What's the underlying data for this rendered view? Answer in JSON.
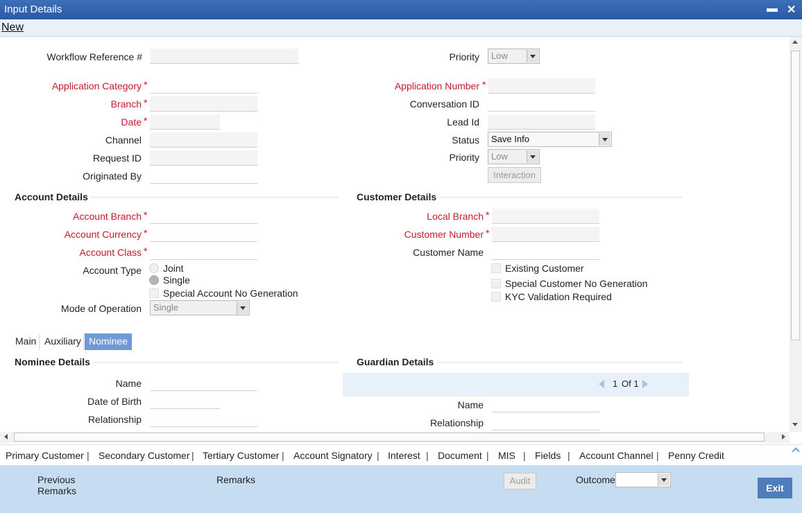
{
  "window": {
    "title": "Input Details",
    "minimize": "▬",
    "close": "✕"
  },
  "menu": {
    "new": "New"
  },
  "header": {
    "workflow_ref_label": "Workflow Reference #",
    "priority_label": "Priority",
    "priority_value": "Low",
    "app_category_label": "Application Category",
    "app_number_label": "Application Number",
    "branch_label": "Branch",
    "conversation_label": "Conversation ID",
    "date_label": "Date",
    "lead_label": "Lead Id",
    "channel_label": "Channel",
    "status_label": "Status",
    "status_value": "Save Info",
    "request_label": "Request ID",
    "priority2_label": "Priority",
    "priority2_value": "Low",
    "originated_label": "Originated By",
    "interaction_label": "Interaction",
    "required_mark": "*"
  },
  "account": {
    "title": "Account Details",
    "branch_label": "Account Branch",
    "currency_label": "Account Currency",
    "class_label": "Account Class",
    "type_label": "Account Type",
    "joint_label": "Joint",
    "single_label": "Single",
    "special_label": "Special Account No Generation",
    "mode_label": "Mode of Operation",
    "mode_value": "Single"
  },
  "customer": {
    "title": "Customer Details",
    "local_branch_label": "Local Branch",
    "number_label": "Customer Number",
    "name_label": "Customer Name",
    "existing_label": "Existing Customer",
    "special_label": "Special Customer No Generation",
    "kyc_label": "KYC Validation Required"
  },
  "tabs": [
    {
      "label": "Main",
      "active": false
    },
    {
      "label": "Auxiliary",
      "active": false
    },
    {
      "label": "Nominee",
      "active": true
    }
  ],
  "nominee": {
    "title": "Nominee Details",
    "name_label": "Name",
    "dob_label": "Date of Birth",
    "relationship_label": "Relationship"
  },
  "guardian": {
    "title": "Guardian Details",
    "pager_current": "1",
    "pager_of": "Of 1",
    "name_label": "Name",
    "relationship_label": "Relationship"
  },
  "links": [
    "Primary Customer",
    "Secondary Customer",
    "Tertiary Customer",
    "Account Signatory",
    "Interest",
    "Document",
    "MIS",
    "Fields",
    "Account Channel",
    "Penny Credit"
  ],
  "link_separator": "|",
  "footer": {
    "prev_remarks_line1": "Previous",
    "prev_remarks_line2": "Remarks",
    "remarks_label": "Remarks",
    "audit_label": "Audit",
    "outcome_label": "Outcome",
    "outcome_value": "",
    "exit_label": "Exit"
  },
  "colors": {
    "titlebar": "#2b5aa5",
    "required": "#c5192d",
    "tab_active": "#6f9ad6",
    "footer": "#c6dcf0",
    "exit": "#4f7db9"
  }
}
